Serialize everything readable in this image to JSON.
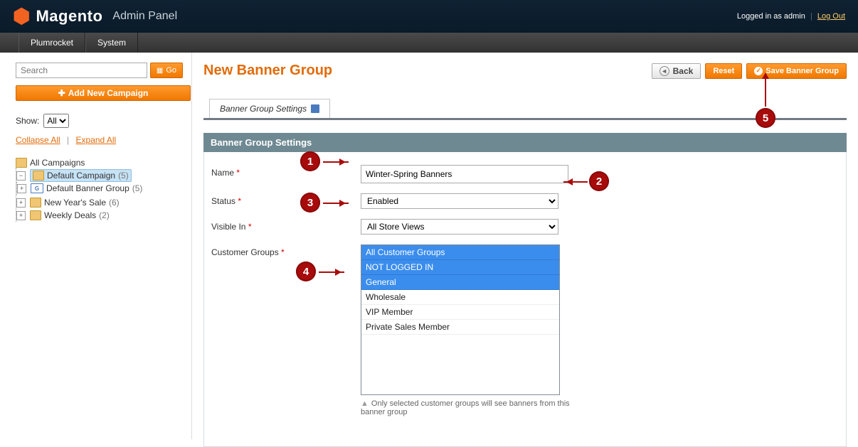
{
  "header": {
    "brand": "Magento",
    "brand_sub": "Admin Panel",
    "logged_in": "Logged in as admin",
    "logout": "Log Out"
  },
  "nav": {
    "items": [
      "Plumrocket",
      "System"
    ]
  },
  "sidebar": {
    "search_placeholder": "Search",
    "go": "Go",
    "add_campaign": "Add New Campaign",
    "show_label": "Show:",
    "show_value": "All",
    "collapse": "Collapse All",
    "expand": "Expand All",
    "tree": {
      "root": "All Campaigns",
      "items": [
        {
          "label": "Default Campaign",
          "count": "(5)",
          "selected": true,
          "children": [
            {
              "label": "Default Banner Group",
              "count": "(5)",
              "type": "group"
            }
          ]
        },
        {
          "label": "New Year's Sale",
          "count": "(6)"
        },
        {
          "label": "Weekly Deals",
          "count": "(2)"
        }
      ]
    }
  },
  "page": {
    "title": "New Banner Group",
    "back": "Back",
    "reset": "Reset",
    "save": "Save Banner Group",
    "tab": "Banner Group Settings",
    "section": "Banner Group Settings"
  },
  "form": {
    "name_label": "Name",
    "name_value": "Winter-Spring Banners",
    "status_label": "Status",
    "status_value": "Enabled",
    "visible_label": "Visible In",
    "visible_value": "All Store Views",
    "groups_label": "Customer Groups",
    "groups_options": [
      {
        "label": "All Customer Groups",
        "sel": true
      },
      {
        "label": "NOT LOGGED IN",
        "sel": true
      },
      {
        "label": "General",
        "sel": true
      },
      {
        "label": "Wholesale",
        "sel": false
      },
      {
        "label": "VIP Member",
        "sel": false
      },
      {
        "label": "Private Sales Member",
        "sel": false
      }
    ],
    "groups_hint": "Only selected customer groups will see banners from this banner group"
  },
  "annotations": {
    "b1": "1",
    "b2": "2",
    "b3": "3",
    "b4": "4",
    "b5": "5"
  }
}
